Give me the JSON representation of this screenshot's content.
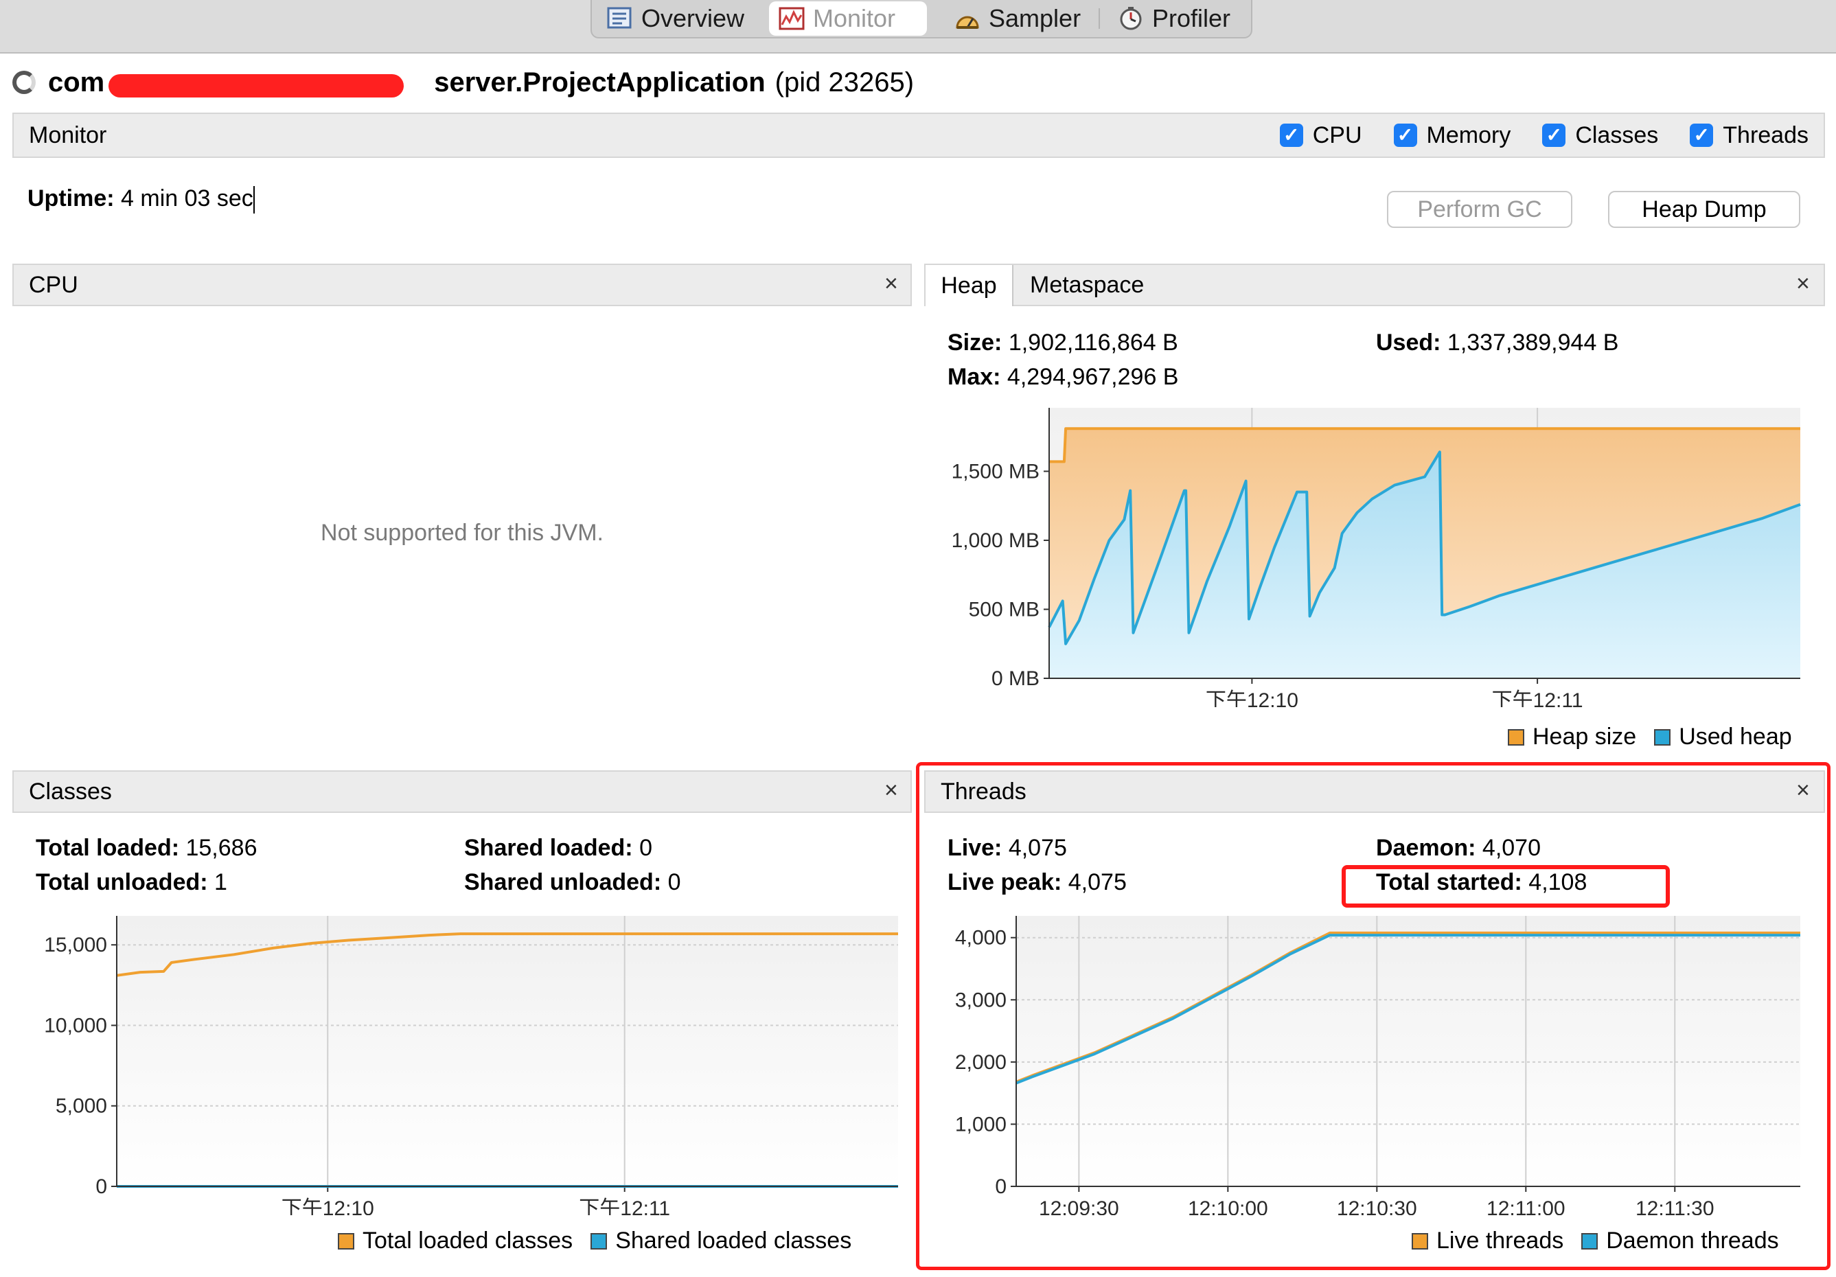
{
  "tabs": [
    {
      "label": "Overview",
      "icon": "overview-icon"
    },
    {
      "label": "Monitor",
      "icon": "monitor-icon",
      "active": true
    },
    {
      "label": "Sampler",
      "icon": "sampler-icon"
    },
    {
      "label": "Profiler",
      "icon": "profiler-icon"
    }
  ],
  "app": {
    "name_prefix": "com",
    "name_suffix": "server.ProjectApplication",
    "pid": "(pid 23265)"
  },
  "monitor": {
    "title": "Monitor",
    "checkboxes": [
      {
        "label": "CPU",
        "checked": true
      },
      {
        "label": "Memory",
        "checked": true
      },
      {
        "label": "Classes",
        "checked": true
      },
      {
        "label": "Threads",
        "checked": true
      }
    ],
    "uptime_label": "Uptime:",
    "uptime_value": "4 min 03 sec",
    "perform_gc": "Perform GC",
    "heap_dump": "Heap Dump"
  },
  "cpu": {
    "title": "CPU",
    "message": "Not supported for this JVM.",
    "close": "×"
  },
  "heap": {
    "tab_heap": "Heap",
    "tab_metaspace": "Metaspace",
    "close": "×",
    "size_label": "Size:",
    "size_value": "1,902,116,864 B",
    "used_label": "Used:",
    "used_value": "1,337,389,944 B",
    "max_label": "Max:",
    "max_value": "4,294,967,296 B",
    "legend": [
      {
        "label": "Heap size",
        "color": "#f0a030"
      },
      {
        "label": "Used heap",
        "color": "#2aa7d6"
      }
    ]
  },
  "classes": {
    "title": "Classes",
    "close": "×",
    "total_loaded_label": "Total loaded:",
    "total_loaded_value": "15,686",
    "shared_loaded_label": "Shared loaded:",
    "shared_loaded_value": "0",
    "total_unloaded_label": "Total unloaded:",
    "total_unloaded_value": "1",
    "shared_unloaded_label": "Shared unloaded:",
    "shared_unloaded_value": "0",
    "legend": [
      {
        "label": "Total loaded classes",
        "color": "#f0a030"
      },
      {
        "label": "Shared loaded classes",
        "color": "#2aa7d6"
      }
    ]
  },
  "threads": {
    "title": "Threads",
    "close": "×",
    "live_label": "Live:",
    "live_value": "4,075",
    "daemon_label": "Daemon:",
    "daemon_value": "4,070",
    "peak_label": "Live peak:",
    "peak_value": "4,075",
    "total_label": "Total started:",
    "total_value": "4,108",
    "legend": [
      {
        "label": "Live threads",
        "color": "#f0a030"
      },
      {
        "label": "Daemon threads",
        "color": "#2aa7d6"
      }
    ]
  },
  "chart_data": [
    {
      "type": "area",
      "yticks": [
        "0 MB",
        "500 MB",
        "1,000 MB",
        "1,500 MB"
      ],
      "ytick_values": [
        0,
        500,
        1000,
        1500
      ],
      "ylim": [
        0,
        1960
      ],
      "xticks": [
        "下午12:10",
        "下午12:11"
      ],
      "xtick_values": [
        0.27,
        0.65
      ],
      "series": [
        {
          "name": "Heap size",
          "color": "#f0a030",
          "x": [
            0,
            0.02,
            0.022,
            0.03,
            1.0
          ],
          "values": [
            1570,
            1570,
            1810,
            1810,
            1810
          ]
        },
        {
          "name": "Used heap",
          "color": "#2aa7d6",
          "x": [
            0,
            0.018,
            0.022,
            0.04,
            0.06,
            0.08,
            0.1,
            0.108,
            0.112,
            0.13,
            0.15,
            0.18,
            0.182,
            0.186,
            0.21,
            0.24,
            0.262,
            0.266,
            0.28,
            0.3,
            0.33,
            0.343,
            0.347,
            0.36,
            0.38,
            0.39,
            0.41,
            0.43,
            0.46,
            0.5,
            0.52,
            0.523,
            0.527,
            0.56,
            0.6,
            0.65,
            0.7,
            0.75,
            0.8,
            0.85,
            0.9,
            0.95,
            1.0
          ],
          "values": [
            370,
            560,
            250,
            420,
            720,
            1000,
            1150,
            1360,
            330,
            600,
            900,
            1360,
            1360,
            330,
            700,
            1100,
            1430,
            430,
            650,
            950,
            1350,
            1350,
            450,
            620,
            800,
            1050,
            1200,
            1300,
            1400,
            1460,
            1640,
            460,
            460,
            520,
            600,
            680,
            760,
            840,
            920,
            1000,
            1080,
            1160,
            1260
          ]
        }
      ]
    },
    {
      "type": "line",
      "yticks": [
        "0",
        "5,000",
        "10,000",
        "15,000"
      ],
      "ytick_values": [
        0,
        5000,
        10000,
        15000
      ],
      "ylim": [
        0,
        16800
      ],
      "xticks": [
        "下午12:10",
        "下午12:11"
      ],
      "xtick_values": [
        0.27,
        0.65
      ],
      "series": [
        {
          "name": "Total loaded classes",
          "color": "#f0a030",
          "x": [
            0,
            0.03,
            0.06,
            0.07,
            0.1,
            0.15,
            0.2,
            0.25,
            0.3,
            0.35,
            0.4,
            0.44,
            1.0
          ],
          "values": [
            13100,
            13300,
            13350,
            13900,
            14100,
            14400,
            14800,
            15100,
            15300,
            15450,
            15600,
            15686,
            15686
          ]
        },
        {
          "name": "Shared loaded classes",
          "color": "#2aa7d6",
          "x": [
            0,
            1.0
          ],
          "values": [
            0,
            0
          ]
        }
      ]
    },
    {
      "type": "line",
      "yticks": [
        "0",
        "1,000",
        "2,000",
        "3,000",
        "4,000"
      ],
      "ytick_values": [
        0,
        1000,
        2000,
        3000,
        4000
      ],
      "ylim": [
        0,
        4350
      ],
      "xticks": [
        "12:09:30",
        "12:10:00",
        "12:10:30",
        "12:11:00",
        "12:11:30"
      ],
      "xtick_values": [
        0.08,
        0.27,
        0.46,
        0.65,
        0.84
      ],
      "series": [
        {
          "name": "Live threads",
          "color": "#f0a030",
          "x": [
            0,
            0.02,
            0.1,
            0.2,
            0.3,
            0.35,
            0.4,
            1.0
          ],
          "values": [
            1680,
            1780,
            2150,
            2720,
            3400,
            3760,
            4075,
            4075
          ]
        },
        {
          "name": "Daemon threads",
          "color": "#2aa7d6",
          "x": [
            0,
            0.02,
            0.1,
            0.2,
            0.3,
            0.35,
            0.4,
            1.0
          ],
          "values": [
            1660,
            1760,
            2130,
            2700,
            3380,
            3740,
            4040,
            4040
          ]
        }
      ]
    }
  ]
}
